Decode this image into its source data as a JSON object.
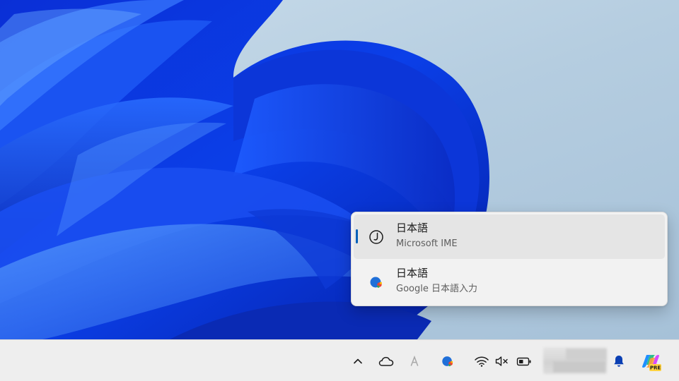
{
  "ime_menu": {
    "items": [
      {
        "language": "日本語",
        "method": "Microsoft IME",
        "icon": "microsoft-ime-icon",
        "selected": true
      },
      {
        "language": "日本語",
        "method": "Google 日本語入力",
        "icon": "google-japanese-input-icon",
        "selected": false
      }
    ]
  },
  "taskbar": {
    "tray_icons": [
      "chevron-up-icon",
      "onedrive-cloud-icon",
      "ime-mode-a-icon",
      "google-ime-icon",
      "wifi-icon",
      "volume-muted-icon",
      "battery-icon"
    ],
    "copilot_badge": "PRE"
  },
  "colors": {
    "accent": "#005fb8",
    "taskbar": "#eeeeee",
    "flyout": "#f2f2f2"
  }
}
